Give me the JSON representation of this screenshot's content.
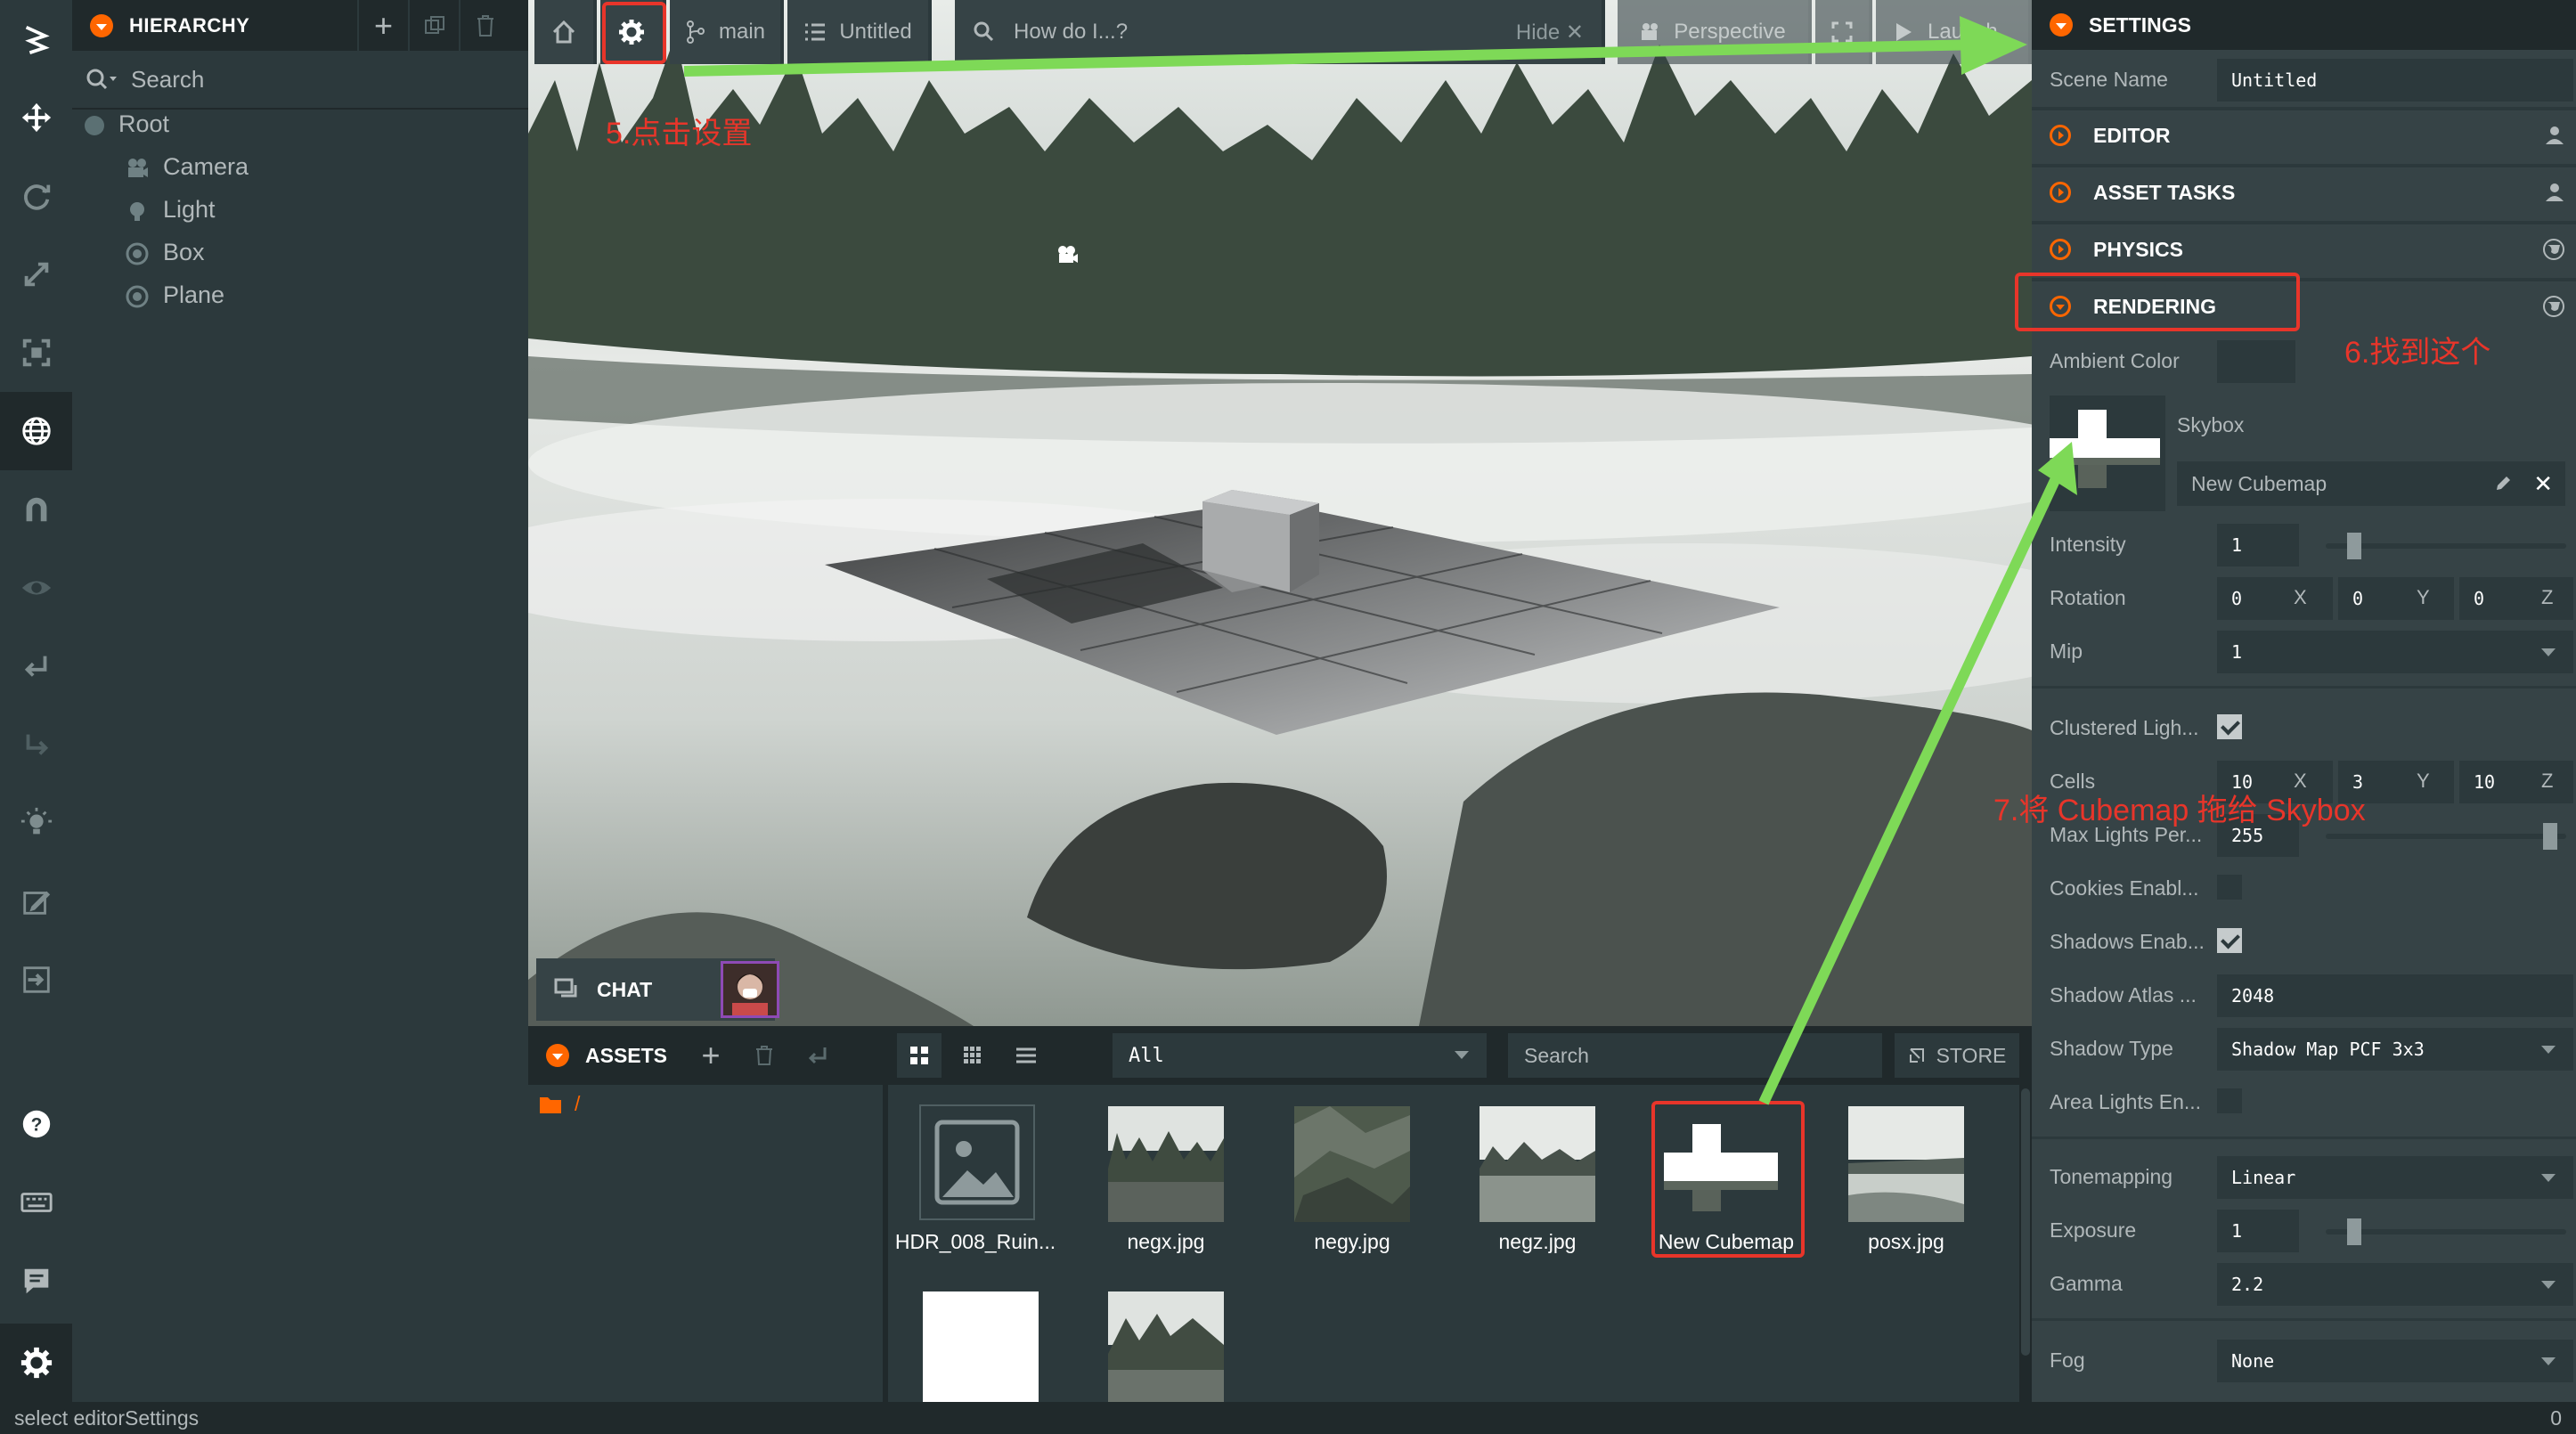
{
  "toolbar": {
    "items": [
      "move-tool",
      "rotate-tool",
      "scale-tool",
      "resize-tool",
      "world-toggle",
      "snap-toggle",
      "view-toggle",
      "undo",
      "redo",
      "lightmapper",
      "code-editor",
      "publish",
      "help",
      "shortcuts",
      "feedback",
      "settings"
    ]
  },
  "hierarchy": {
    "title": "HIERARCHY",
    "search_placeholder": "Search",
    "root_label": "Root",
    "children": [
      "Camera",
      "Light",
      "Box",
      "Plane"
    ]
  },
  "viewport_toolbar": {
    "branch": "main",
    "scene": "Untitled",
    "help_search": "How do I...?",
    "hide": "Hide",
    "camera": "Perspective",
    "launch": "Launch"
  },
  "chat": {
    "label": "CHAT"
  },
  "assets": {
    "title": "ASSETS",
    "filter": "All",
    "search_placeholder": "Search",
    "store": "STORE",
    "path": "/",
    "items": [
      {
        "name": "HDR_008_Ruin..."
      },
      {
        "name": "negx.jpg"
      },
      {
        "name": "negy.jpg"
      },
      {
        "name": "negz.jpg"
      },
      {
        "name": "New Cubemap"
      },
      {
        "name": "posx.jpg"
      }
    ]
  },
  "settings": {
    "title": "SETTINGS",
    "scene_name_label": "Scene Name",
    "scene_name_value": "Untitled",
    "sections": [
      "EDITOR",
      "ASSET TASKS",
      "PHYSICS",
      "RENDERING"
    ],
    "ambient_color_label": "Ambient Color",
    "skybox_label": "Skybox",
    "skybox_asset": "New Cubemap",
    "intensity_label": "Intensity",
    "intensity_value": "1",
    "rotation_label": "Rotation",
    "rotation": [
      "0",
      "0",
      "0"
    ],
    "axis_labels": [
      "X",
      "Y",
      "Z"
    ],
    "mip_label": "Mip",
    "mip_value": "1",
    "clustered_label": "Clustered Ligh...",
    "cells_label": "Cells",
    "cells": [
      "10",
      "3",
      "10"
    ],
    "max_lights_label": "Max Lights Per...",
    "max_lights_value": "255",
    "cookies_label": "Cookies Enabl...",
    "shadows_label": "Shadows Enab...",
    "shadow_atlas_label": "Shadow Atlas ...",
    "shadow_atlas_value": "2048",
    "shadow_type_label": "Shadow Type",
    "shadow_type_value": "Shadow Map PCF 3x3",
    "area_lights_label": "Area Lights En...",
    "tonemapping_label": "Tonemapping",
    "tonemapping_value": "Linear",
    "exposure_label": "Exposure",
    "exposure_value": "1",
    "gamma_label": "Gamma",
    "gamma_value": "2.2",
    "fog_label": "Fog",
    "fog_value": "None",
    "checkbox_states": {
      "clustered": true,
      "cookies": false,
      "shadows": true,
      "area_lights": false
    }
  },
  "annotations": {
    "step5": "5.点击设置",
    "step6": "6.找到这个",
    "step7": "7.将 Cubemap 拖给 Skybox"
  },
  "status": {
    "text": "select editorSettings",
    "count": "0"
  },
  "colors": {
    "accent": "#ff6600",
    "annotation_red": "#e8352a",
    "arrow_green": "#7ed957"
  }
}
